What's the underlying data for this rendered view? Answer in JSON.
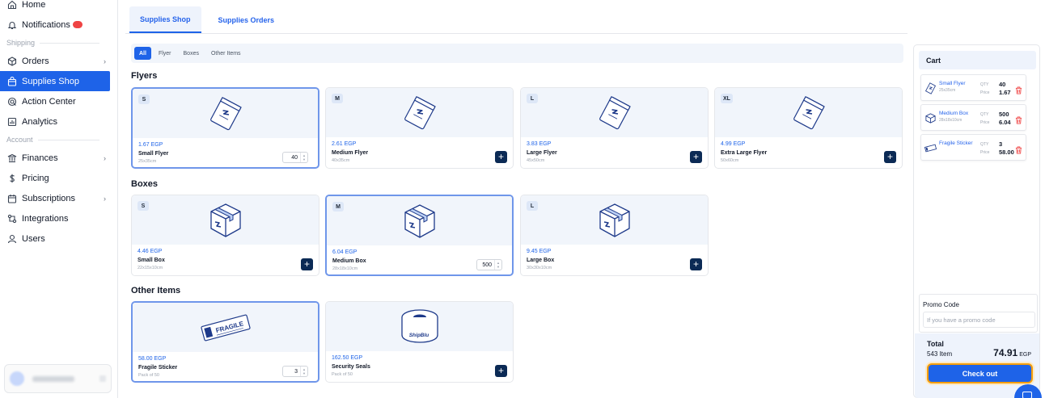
{
  "sidebar": {
    "items_top": [
      {
        "label": "Home",
        "icon": "home-icon"
      },
      {
        "label": "Notifications",
        "icon": "bell-icon",
        "badge": true
      }
    ],
    "section_shipping": "Shipping",
    "items_shipping": [
      {
        "label": "Orders",
        "icon": "box-icon",
        "chevron": true
      },
      {
        "label": "Supplies Shop",
        "icon": "bag-icon",
        "active": true
      },
      {
        "label": "Action Center",
        "icon": "target-icon"
      },
      {
        "label": "Analytics",
        "icon": "chart-icon"
      }
    ],
    "section_account": "Account",
    "items_account": [
      {
        "label": "Finances",
        "icon": "bank-icon",
        "chevron": true
      },
      {
        "label": "Pricing",
        "icon": "dollar-icon"
      },
      {
        "label": "Subscriptions",
        "icon": "calendar-icon",
        "chevron": true
      },
      {
        "label": "Integrations",
        "icon": "integration-icon"
      },
      {
        "label": "Users",
        "icon": "user-icon"
      }
    ]
  },
  "tabs": [
    {
      "label": "Supplies Shop",
      "active": true
    },
    {
      "label": "Supplies Orders",
      "active": false
    }
  ],
  "filters": [
    {
      "label": "All",
      "active": true
    },
    {
      "label": "Flyer"
    },
    {
      "label": "Boxes"
    },
    {
      "label": "Other Items"
    }
  ],
  "sections": {
    "flyers": {
      "title": "Flyers",
      "products": [
        {
          "size": "S",
          "price": "1.67 EGP",
          "name": "Small Flyer",
          "dim": "25x35cm",
          "qty": "40",
          "selected": true
        },
        {
          "size": "M",
          "price": "2.61 EGP",
          "name": "Medium Flyer",
          "dim": "40x35cm"
        },
        {
          "size": "L",
          "price": "3.83 EGP",
          "name": "Large Flyer",
          "dim": "45x50cm"
        },
        {
          "size": "XL",
          "price": "4.99 EGP",
          "name": "Extra Large Flyer",
          "dim": "50x60cm"
        }
      ]
    },
    "boxes": {
      "title": "Boxes",
      "products": [
        {
          "size": "S",
          "price": "4.46 EGP",
          "name": "Small Box",
          "dim": "22x15x10cm"
        },
        {
          "size": "M",
          "price": "6.04 EGP",
          "name": "Medium Box",
          "dim": "28x18x10cm",
          "qty": "500",
          "selected": true
        },
        {
          "size": "L",
          "price": "9.45 EGP",
          "name": "Large Box",
          "dim": "30x30x10cm"
        }
      ]
    },
    "other": {
      "title": "Other Items",
      "products": [
        {
          "price": "58.00 EGP",
          "name": "Fragile Sticker",
          "dim": "Pack of 50",
          "qty": "3",
          "selected": true,
          "sticker_text": "FRAGILE"
        },
        {
          "price": "162.50 EGP",
          "name": "Security Seals",
          "dim": "Pack of 50",
          "tape_text": "ShipBlu"
        }
      ]
    }
  },
  "cart": {
    "title": "Cart",
    "qty_label": "QTY",
    "price_label": "Price",
    "items": [
      {
        "name": "Small Flyer",
        "dim": "25x35cm",
        "qty": "40",
        "price": "1.67",
        "kind": "flyer"
      },
      {
        "name": "Medium Box",
        "dim": "28x18x10cm",
        "qty": "500",
        "price": "6.04",
        "kind": "box"
      },
      {
        "name": "Fragile Sticker",
        "dim": "",
        "qty": "3",
        "price": "58.00",
        "kind": "sticker"
      }
    ],
    "promo_label": "Promo Code",
    "promo_placeholder": "If you have a promo code",
    "total_label": "Total",
    "items_count": "543 Item",
    "total_amount": "74.91",
    "currency": "EGP",
    "checkout_label": "Check out"
  },
  "colors": {
    "accent": "#1e63e8",
    "dark_button": "#0b2a55",
    "checkout_outline": "#f59e0b"
  }
}
